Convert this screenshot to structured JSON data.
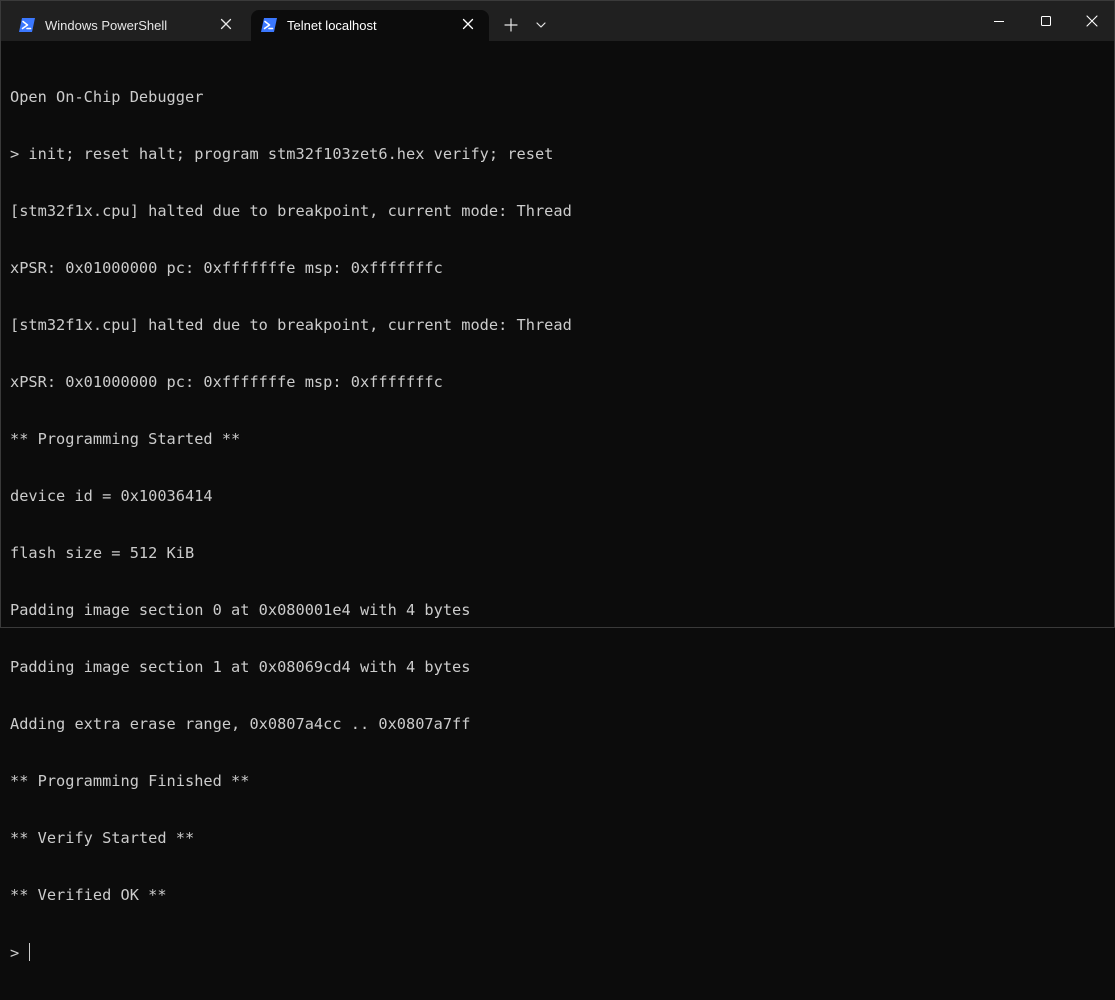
{
  "tabs": [
    {
      "label": "Windows PowerShell",
      "icon": "powershell-icon",
      "active": false
    },
    {
      "label": "Telnet localhost",
      "icon": "powershell-icon",
      "active": true
    }
  ],
  "titlebar": {
    "new_tab_icon": "plus-icon",
    "dropdown_icon": "chevron-down-icon",
    "minimize_icon": "minimize-icon",
    "maximize_icon": "maximize-icon",
    "close_icon": "close-icon"
  },
  "terminal": {
    "lines": [
      "Open On-Chip Debugger",
      "> init; reset halt; program stm32f103zet6.hex verify; reset",
      "[stm32f1x.cpu] halted due to breakpoint, current mode: Thread",
      "xPSR: 0x01000000 pc: 0xfffffffe msp: 0xfffffffc",
      "[stm32f1x.cpu] halted due to breakpoint, current mode: Thread",
      "xPSR: 0x01000000 pc: 0xfffffffe msp: 0xfffffffc",
      "** Programming Started **",
      "device id = 0x10036414",
      "flash size = 512 KiB",
      "Padding image section 0 at 0x080001e4 with 4 bytes",
      "Padding image section 1 at 0x08069cd4 with 4 bytes",
      "Adding extra erase range, 0x0807a4cc .. 0x0807a7ff",
      "** Programming Finished **",
      "** Verify Started **",
      "** Verified OK **"
    ],
    "prompt": "> "
  },
  "colors": {
    "background": "#0c0c0c",
    "titlebar": "#202020",
    "text": "#cccccc",
    "accent": "#3b78ff"
  }
}
